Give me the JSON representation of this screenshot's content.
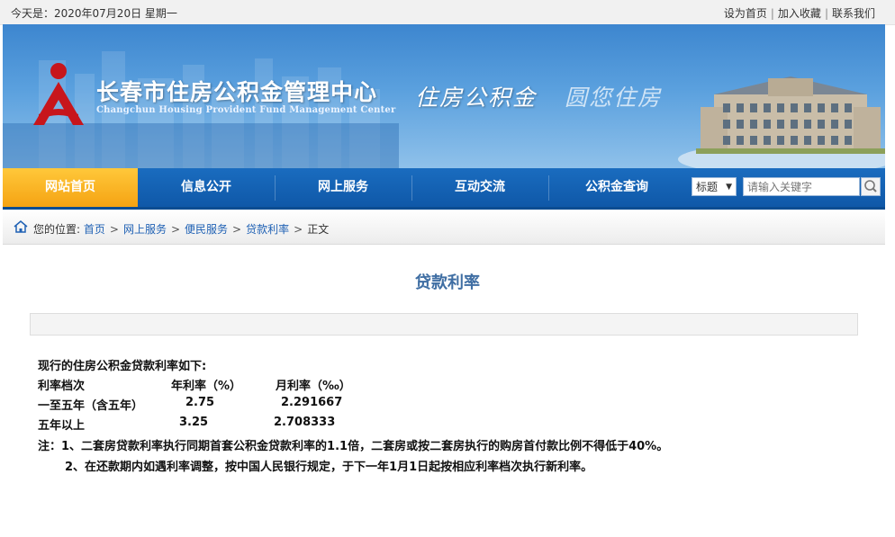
{
  "topbar": {
    "date": "今天是：2020年07月20日 星期一",
    "links": [
      "设为首页",
      "加入收藏",
      "联系我们"
    ]
  },
  "banner": {
    "org_name": "长春市住房公积金管理中心",
    "org_name_en": "Changchun Housing Provident Fund Management Center",
    "slogan_1": "住房公积金",
    "slogan_2": "圆您住房"
  },
  "nav": {
    "items": [
      "网站首页",
      "信息公开",
      "网上服务",
      "互动交流",
      "公积金查询"
    ],
    "active_index": 0,
    "search_type": "标题",
    "search_placeholder": "请输入关键字"
  },
  "breadcrumb": {
    "prefix": "您的位置:",
    "items": [
      "首页",
      "网上服务",
      "便民服务",
      "贷款利率"
    ],
    "current": "正文"
  },
  "article": {
    "title": "贷款利率",
    "intro": "现行的住房公积金贷款利率如下:",
    "table": {
      "headers": [
        "利率档次",
        "年利率（%）",
        "月利率（‰）"
      ],
      "rows": [
        [
          "一至五年（含五年）",
          "2.75",
          "2.291667"
        ],
        [
          "五年以上",
          "3.25",
          "2.708333"
        ]
      ]
    },
    "notes": [
      "注：1、二套房贷款利率执行同期首套公积金贷款利率的1.1倍，二套房或按二套房执行的购房首付款比例不得低于40%。",
      "2、在还款期内如遇利率调整，按中国人民银行规定，于下一年1月1日起按相应利率档次执行新利率。"
    ]
  },
  "colors": {
    "nav_blue": "#1462b3",
    "nav_active": "#f8b020",
    "title_blue": "#3f6ea3",
    "link_blue": "#1f61b4"
  }
}
